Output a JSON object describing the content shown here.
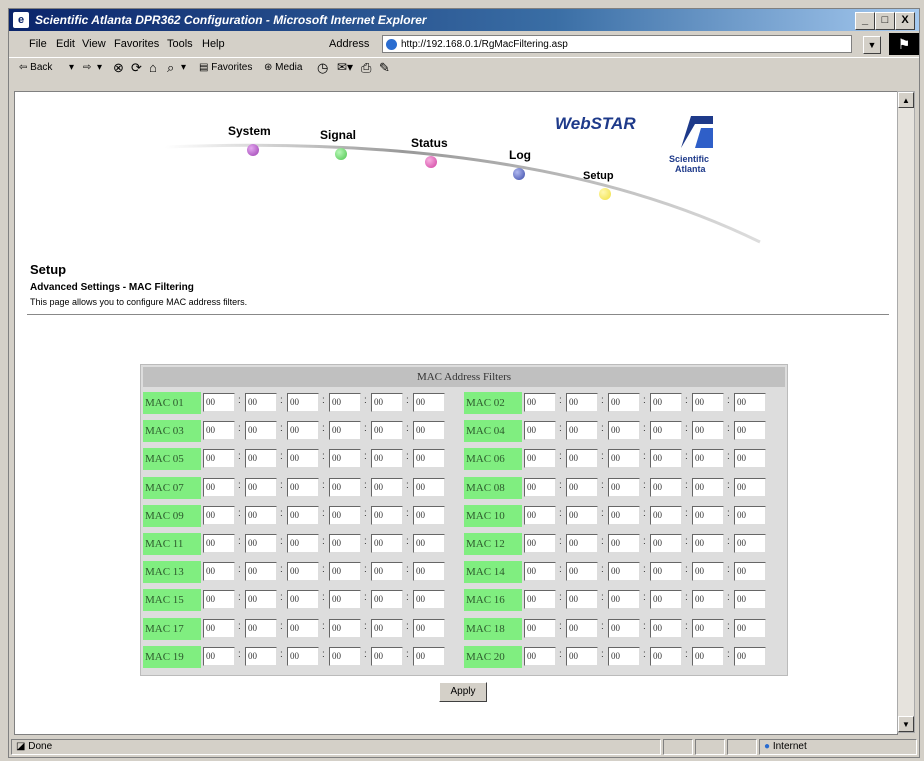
{
  "window": {
    "title": "Scientific Atlanta DPR362 Configuration - Microsoft Internet Explorer",
    "icon": "ie-icon",
    "controls": {
      "minimize": "_",
      "maximize": "□",
      "close": "X"
    }
  },
  "menu": {
    "items": [
      "File",
      "Edit",
      "View",
      "Favorites",
      "Tools",
      "Help"
    ],
    "address_label": "Address",
    "address_value": "http://192.168.0.1/RgMacFiltering.asp"
  },
  "toolbar": {
    "back": "⇦ Back",
    "back_dd": "▾",
    "forward": "⇨",
    "forward_dd": "▾",
    "stop": "⊗",
    "refresh": "⟳",
    "home": "⌂",
    "search": "⌕",
    "search_dd": "▾",
    "favorites": "Favorites",
    "media": "Media",
    "history": "◷",
    "mail": "✉▾",
    "print": "⎙",
    "edit": "✎"
  },
  "header": {
    "nav": [
      "System",
      "Signal",
      "Status",
      "Log",
      "Setup"
    ],
    "brand": "WebSTAR",
    "company_line1": "Scientific",
    "company_line2": "Atlanta"
  },
  "page": {
    "title": "Setup",
    "subtitle": "Advanced Settings - MAC Filtering",
    "description": "This page allows you to configure MAC address filters."
  },
  "table": {
    "header": "MAC Address Filters",
    "rows": [
      {
        "left": {
          "label": "MAC 01",
          "octets": [
            "00",
            "00",
            "00",
            "00",
            "00",
            "00"
          ]
        },
        "right": {
          "label": "MAC 02",
          "octets": [
            "00",
            "00",
            "00",
            "00",
            "00",
            "00"
          ]
        }
      },
      {
        "left": {
          "label": "MAC 03",
          "octets": [
            "00",
            "00",
            "00",
            "00",
            "00",
            "00"
          ]
        },
        "right": {
          "label": "MAC 04",
          "octets": [
            "00",
            "00",
            "00",
            "00",
            "00",
            "00"
          ]
        }
      },
      {
        "left": {
          "label": "MAC 05",
          "octets": [
            "00",
            "00",
            "00",
            "00",
            "00",
            "00"
          ]
        },
        "right": {
          "label": "MAC 06",
          "octets": [
            "00",
            "00",
            "00",
            "00",
            "00",
            "00"
          ]
        }
      },
      {
        "left": {
          "label": "MAC 07",
          "octets": [
            "00",
            "00",
            "00",
            "00",
            "00",
            "00"
          ]
        },
        "right": {
          "label": "MAC 08",
          "octets": [
            "00",
            "00",
            "00",
            "00",
            "00",
            "00"
          ]
        }
      },
      {
        "left": {
          "label": "MAC 09",
          "octets": [
            "00",
            "00",
            "00",
            "00",
            "00",
            "00"
          ]
        },
        "right": {
          "label": "MAC 10",
          "octets": [
            "00",
            "00",
            "00",
            "00",
            "00",
            "00"
          ]
        }
      },
      {
        "left": {
          "label": "MAC 11",
          "octets": [
            "00",
            "00",
            "00",
            "00",
            "00",
            "00"
          ]
        },
        "right": {
          "label": "MAC 12",
          "octets": [
            "00",
            "00",
            "00",
            "00",
            "00",
            "00"
          ]
        }
      },
      {
        "left": {
          "label": "MAC 13",
          "octets": [
            "00",
            "00",
            "00",
            "00",
            "00",
            "00"
          ]
        },
        "right": {
          "label": "MAC 14",
          "octets": [
            "00",
            "00",
            "00",
            "00",
            "00",
            "00"
          ]
        }
      },
      {
        "left": {
          "label": "MAC 15",
          "octets": [
            "00",
            "00",
            "00",
            "00",
            "00",
            "00"
          ]
        },
        "right": {
          "label": "MAC 16",
          "octets": [
            "00",
            "00",
            "00",
            "00",
            "00",
            "00"
          ]
        }
      },
      {
        "left": {
          "label": "MAC 17",
          "octets": [
            "00",
            "00",
            "00",
            "00",
            "00",
            "00"
          ]
        },
        "right": {
          "label": "MAC 18",
          "octets": [
            "00",
            "00",
            "00",
            "00",
            "00",
            "00"
          ]
        }
      },
      {
        "left": {
          "label": "MAC 19",
          "octets": [
            "00",
            "00",
            "00",
            "00",
            "00",
            "00"
          ]
        },
        "right": {
          "label": "MAC 20",
          "octets": [
            "00",
            "00",
            "00",
            "00",
            "00",
            "00"
          ]
        }
      }
    ],
    "apply_label": "Apply"
  },
  "status": {
    "left": "Done",
    "zone": "Internet"
  },
  "colors": {
    "title_bar": "#0a246a",
    "mac_label_bg": "#80ee80",
    "dot_system": "#9b3fb0",
    "dot_signal": "#4cc44c",
    "dot_status": "#d03fa0",
    "dot_log": "#3a4aa8",
    "dot_setup": "#f0e040"
  }
}
